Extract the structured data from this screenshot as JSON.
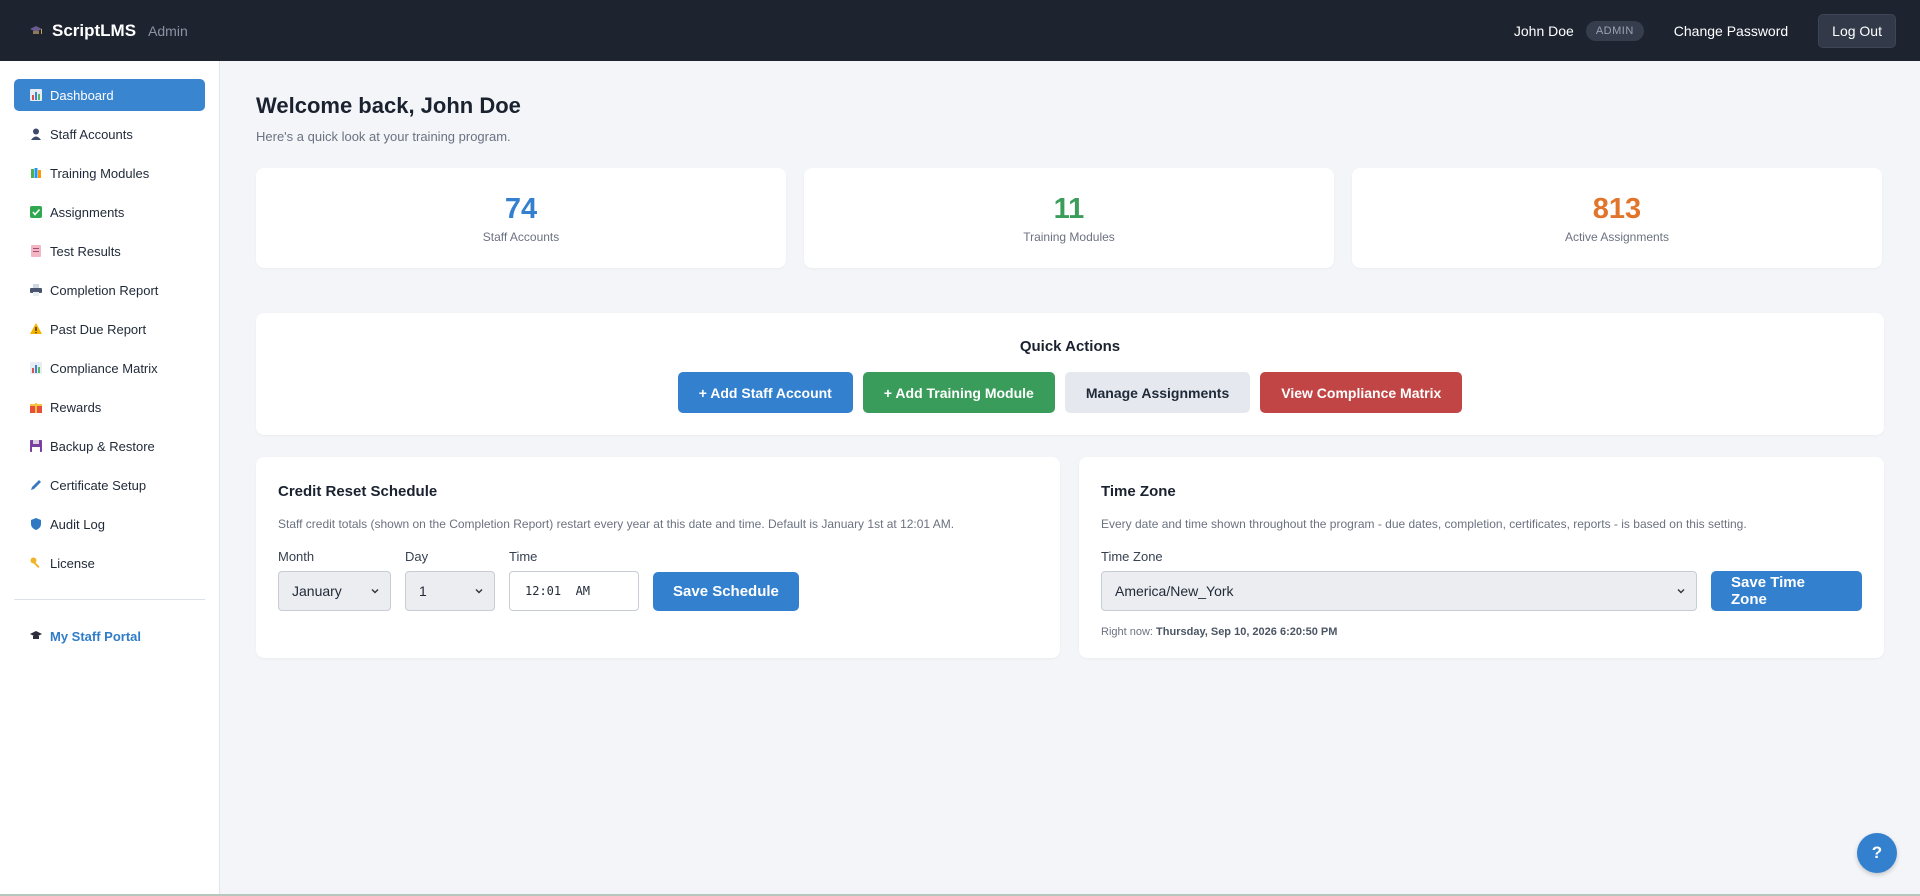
{
  "header": {
    "app_name": "ScriptLMS",
    "app_role": "Admin",
    "user_name": "John Doe",
    "role_badge": "ADMIN",
    "change_password": "Change Password",
    "logout": "Log Out"
  },
  "sidebar": {
    "items": [
      {
        "label": "Dashboard",
        "icon": "chart-icon"
      },
      {
        "label": "Staff Accounts",
        "icon": "person-icon"
      },
      {
        "label": "Training Modules",
        "icon": "books-icon"
      },
      {
        "label": "Assignments",
        "icon": "checkbox-icon"
      },
      {
        "label": "Test Results",
        "icon": "notes-icon"
      },
      {
        "label": "Completion Report",
        "icon": "printer-icon"
      },
      {
        "label": "Past Due Report",
        "icon": "warning-icon"
      },
      {
        "label": "Compliance Matrix",
        "icon": "bar-chart-icon"
      },
      {
        "label": "Rewards",
        "icon": "gift-icon"
      },
      {
        "label": "Backup & Restore",
        "icon": "floppy-icon"
      },
      {
        "label": "Certificate Setup",
        "icon": "pen-icon"
      },
      {
        "label": "Audit Log",
        "icon": "shield-icon"
      },
      {
        "label": "License",
        "icon": "key-icon"
      }
    ],
    "portal": "My Staff Portal"
  },
  "main": {
    "welcome": "Welcome back, John Doe",
    "subtitle": "Here's a quick look at your training program.",
    "stats": [
      {
        "value": "74",
        "label": "Staff Accounts"
      },
      {
        "value": "11",
        "label": "Training Modules"
      },
      {
        "value": "813",
        "label": "Active Assignments"
      }
    ],
    "quick_actions": {
      "title": "Quick Actions",
      "add_staff": "+ Add Staff Account",
      "add_module": "+ Add Training Module",
      "manage": "Manage Assignments",
      "compliance": "View Compliance Matrix"
    },
    "credit_reset": {
      "title": "Credit Reset Schedule",
      "description": "Staff credit totals (shown on the Completion Report) restart every year at this date and time. Default is January 1st at 12:01 AM.",
      "month_label": "Month",
      "month_value": "January",
      "day_label": "Day",
      "day_value": "1",
      "time_label": "Time",
      "time_value": "12:01  AM",
      "save": "Save Schedule"
    },
    "time_zone": {
      "title": "Time Zone",
      "description": "Every date and time shown throughout the program - due dates, completion, certificates, reports - is based on this setting.",
      "label": "Time Zone",
      "value": "America/New_York",
      "save": "Save Time Zone",
      "now_label": "Right now:",
      "now_value": "Thursday, Sep 10, 2026 6:20:50 PM"
    }
  },
  "help": "?",
  "colors": {
    "accent": "#3380cf",
    "green": "#3a9c5b",
    "orange": "#e1752b",
    "red": "#c24545",
    "topbar": "#1e2330"
  }
}
